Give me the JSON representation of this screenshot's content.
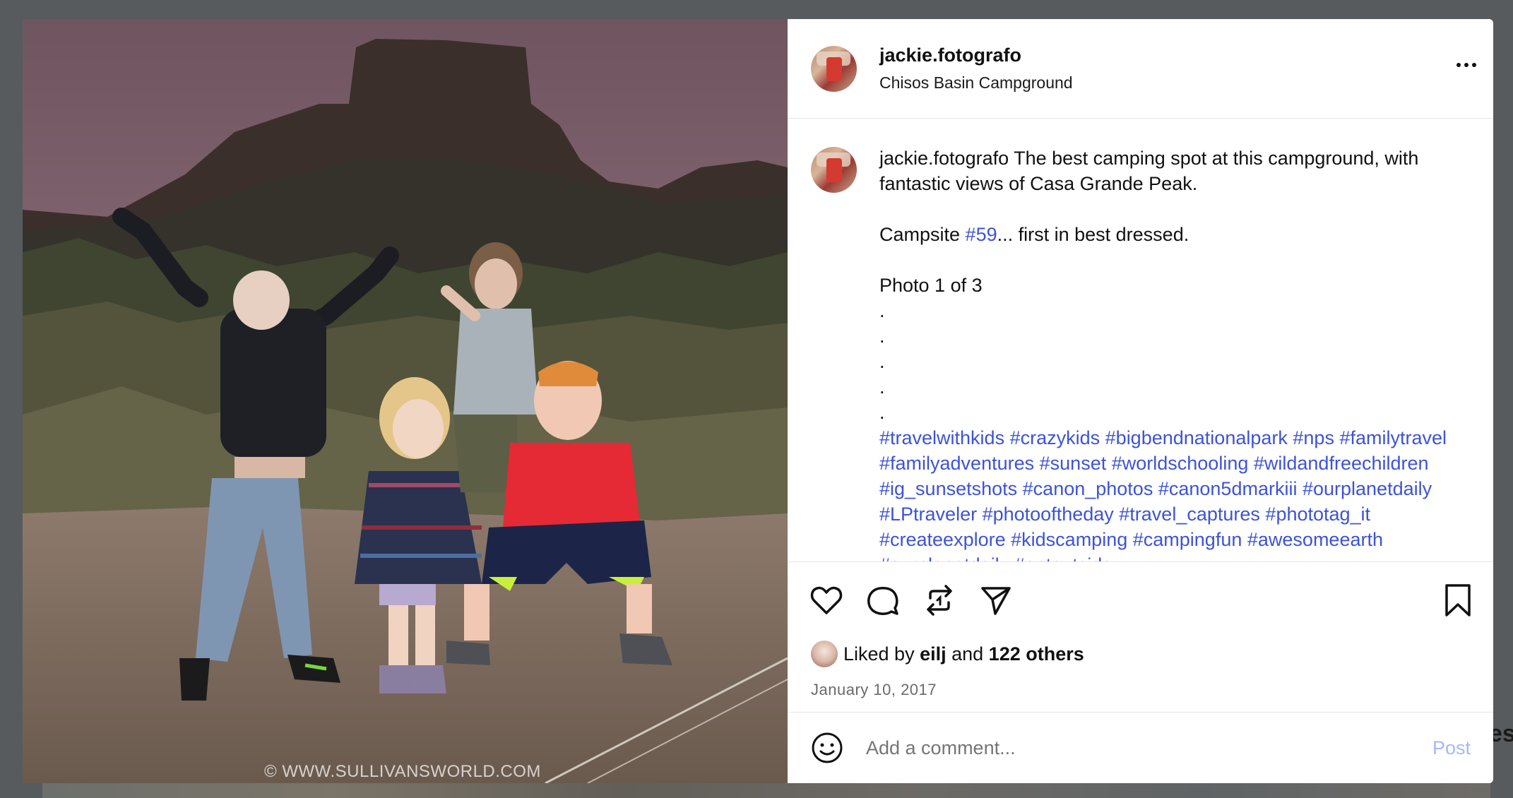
{
  "post": {
    "username": "jackie.fotografo",
    "location": "Chisos Basin Campground",
    "watermark": "© WWW.SULLIVANSWORLD.COM"
  },
  "caption": {
    "username": "jackie.fotografo",
    "line1": " The best camping spot at this campground, with fantastic views of Casa Grande Peak.",
    "line2_prefix": "Campsite ",
    "line2_tag": "#59",
    "line2_suffix": "... first in best dressed.",
    "line3": "Photo 1 of 3",
    "dots": [
      ".",
      ".",
      ".",
      ".",
      "."
    ],
    "hashtags": [
      "#travelwithkids",
      "#crazykids",
      "#bigbendnationalpark",
      "#nps",
      "#familytravel",
      "#familyadventures",
      "#sunset",
      "#worldschooling",
      "#wildandfreechildren",
      "#ig_sunsetshots",
      "#canon_photos",
      "#canon5dmarkiii",
      "#ourplanetdaily",
      "#LPtraveler",
      "#photooftheday",
      "#travel_captures",
      "#phototag_it",
      "#createexplore",
      "#kidscamping",
      "#campingfun",
      "#awesomeearth",
      "#ourplanetdaily",
      "#optoutside"
    ]
  },
  "actions": {
    "icons": [
      "heart-icon",
      "comment-icon",
      "repost-icon",
      "share-icon",
      "bookmark-icon"
    ]
  },
  "likes": {
    "prefix": "Liked by ",
    "user": "eilj",
    "middle": " and ",
    "count": "122 others"
  },
  "date": "January 10, 2017",
  "comment": {
    "placeholder": "Add a comment...",
    "post_label": "Post"
  },
  "background": {
    "partial_text": "es"
  },
  "colors": {
    "hashtag": "#3d53d6",
    "post_button": "#a7b8f3",
    "backdrop": "#575b5e"
  }
}
